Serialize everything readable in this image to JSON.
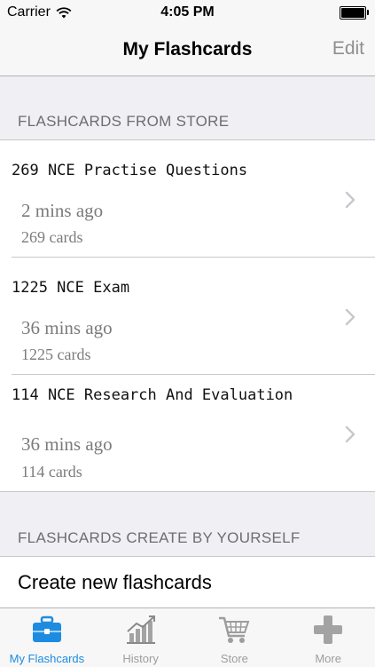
{
  "status_bar": {
    "carrier": "Carrier",
    "time": "4:05 PM",
    "battery_level": 1.0
  },
  "nav": {
    "title": "My Flashcards",
    "edit_label": "Edit"
  },
  "sections": {
    "store_header": "FLASHCARDS FROM STORE",
    "custom_header": "FLASHCARDS CREATE BY YOURSELF"
  },
  "store_items": [
    {
      "title": "269 NCE Practise Questions",
      "time": "2 mins ago",
      "count": "269 cards"
    },
    {
      "title": "1225 NCE Exam",
      "time": "36 mins ago",
      "count": "1225 cards"
    },
    {
      "title": "114 NCE Research And Evaluation",
      "time": "36 mins ago",
      "count": "114 cards"
    }
  ],
  "create_row": {
    "label": "Create new flashcards"
  },
  "tabs": [
    {
      "label": "My Flashcards",
      "icon": "briefcase-icon",
      "active": true
    },
    {
      "label": "History",
      "icon": "chart-icon",
      "active": false
    },
    {
      "label": "Store",
      "icon": "cart-icon",
      "active": false
    },
    {
      "label": "More",
      "icon": "plus-icon",
      "active": false
    }
  ],
  "colors": {
    "accent": "#1d8ce0",
    "inactive": "#9d9d9d",
    "background": "#efeff4"
  }
}
